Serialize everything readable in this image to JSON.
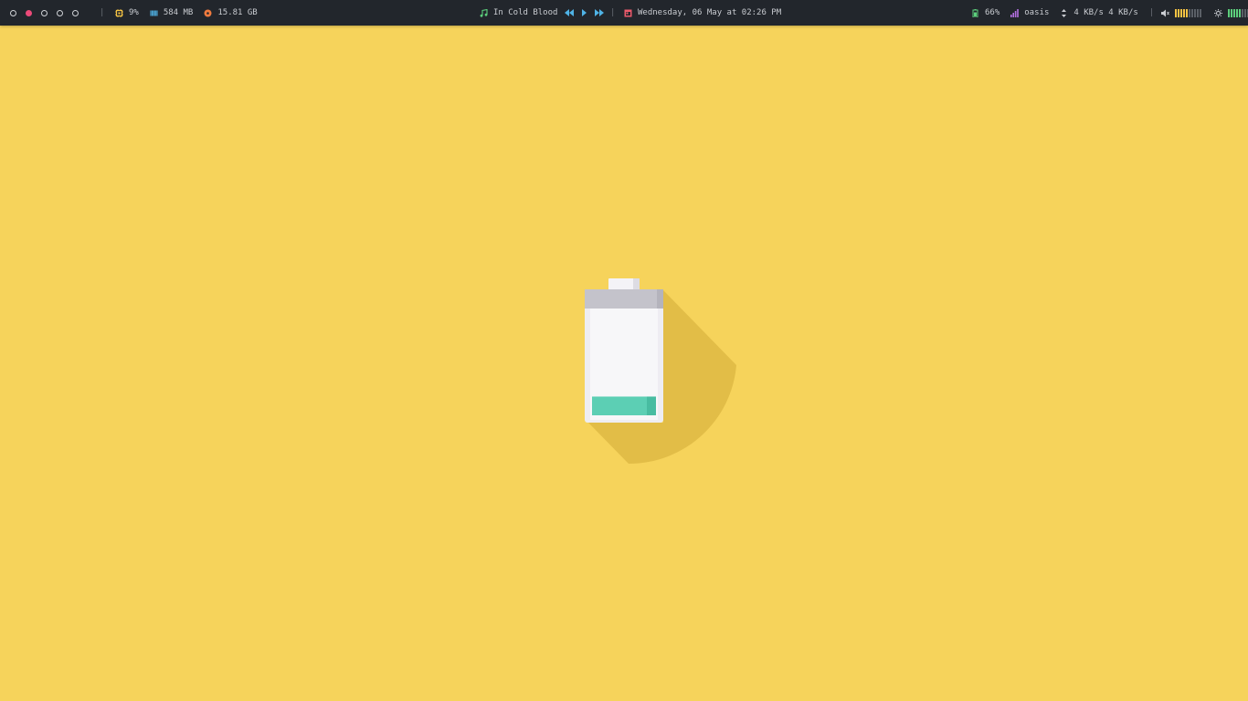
{
  "workspaces": [
    {
      "active": false
    },
    {
      "active": true
    },
    {
      "active": false
    },
    {
      "active": false
    },
    {
      "active": false
    }
  ],
  "separators": [
    "|",
    "|",
    "|"
  ],
  "system": {
    "cpu": {
      "icon": "cpu-icon",
      "value": "9%",
      "color": "#f6c343"
    },
    "memory": {
      "icon": "memory-icon",
      "value": "584 MB",
      "color": "#4fb3e6"
    },
    "disk": {
      "icon": "disk-icon",
      "value": "15.81 GB",
      "color": "#f07b3f"
    }
  },
  "media": {
    "icon": "music-note-icon",
    "title": "In Cold Blood",
    "controls": [
      "previous-icon",
      "play-icon",
      "next-icon"
    ],
    "color": "#5ccf7c"
  },
  "clock": {
    "icon": "calendar-icon",
    "text": "Wednesday, 06 May at 02:26 PM",
    "color": "#ec5a6b"
  },
  "status": {
    "battery": {
      "icon": "battery-icon",
      "value": "66%",
      "color": "#5ccf7c"
    },
    "wifi": {
      "icon": "signal-icon",
      "ssid": "oasis",
      "color": "#b36fe0"
    },
    "network": {
      "icon": "updown-arrows-icon",
      "text": "4 KB/s 4 KB/s"
    },
    "volume": {
      "icon": "speaker-icon",
      "level": 0.45,
      "color": "#f6c343"
    },
    "brightness": {
      "icon": "sun-icon",
      "level": 0.5,
      "color": "#5ccf7c"
    }
  },
  "wallpaper": {
    "background": "#f6d35b",
    "battery_charge": 0.18,
    "charge_color": "#5ccfb4"
  }
}
